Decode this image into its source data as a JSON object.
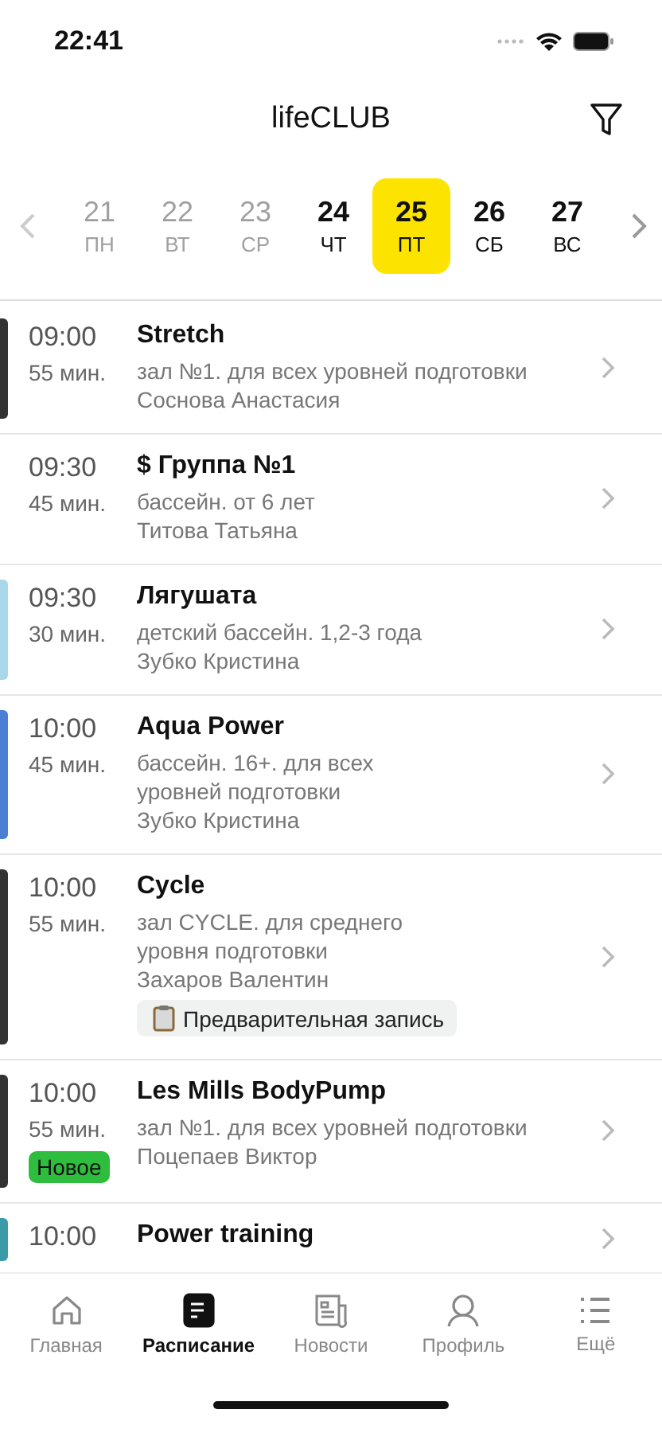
{
  "status_bar": {
    "time": "22:41"
  },
  "header": {
    "title": "lifeCLUB"
  },
  "days": [
    {
      "date": "21",
      "weekday": "ПН",
      "past": true,
      "selected": false
    },
    {
      "date": "22",
      "weekday": "ВТ",
      "past": true,
      "selected": false
    },
    {
      "date": "23",
      "weekday": "СР",
      "past": true,
      "selected": false
    },
    {
      "date": "24",
      "weekday": "ЧТ",
      "past": false,
      "selected": false
    },
    {
      "date": "25",
      "weekday": "ПТ",
      "past": false,
      "selected": true
    },
    {
      "date": "26",
      "weekday": "СБ",
      "past": false,
      "selected": false
    },
    {
      "date": "27",
      "weekday": "ВС",
      "past": false,
      "selected": false
    }
  ],
  "classes": [
    {
      "time": "09:00",
      "duration": "55 мин.",
      "title": "Stretch",
      "details": [
        "зал №1. для всех уровней подготовки",
        "Соснова Анастасия"
      ],
      "color": "#333333"
    },
    {
      "time": "09:30",
      "duration": "45 мин.",
      "title": "$ Группа №1",
      "details": [
        "бассейн. от 6 лет",
        "Титова Татьяна"
      ]
    },
    {
      "time": "09:30",
      "duration": "30 мин.",
      "title": "Лягушата",
      "details": [
        "детский  бассейн. 1,2-3 года",
        "Зубко Кристина"
      ],
      "color": "#a8d8ea"
    },
    {
      "time": "10:00",
      "duration": "45 мин.",
      "title": "Aqua Power",
      "details": [
        "бассейн. 16+. для всех",
        "уровней подготовки",
        "Зубко Кристина"
      ],
      "color": "#4a7fd4"
    },
    {
      "time": "10:00",
      "duration": "55 мин.",
      "title": "Cycle",
      "details": [
        "зал CYCLE. для среднего",
        "уровня подготовки",
        "Захаров Валентин"
      ],
      "note": "Предварительная запись",
      "color": "#333333"
    },
    {
      "time": "10:00",
      "duration": "55 мин.",
      "title": "Les Mills BodyPump",
      "details": [
        "зал №1. для всех уровней подготовки",
        "Поцепаев Виктор"
      ],
      "badge": "Новое",
      "color": "#333333"
    },
    {
      "time": "10:00",
      "title": "Power training",
      "color": "#3a9aa8"
    }
  ],
  "tabs": [
    {
      "label": "Главная",
      "kind": "home",
      "selected": false
    },
    {
      "label": "Расписание",
      "kind": "schedule",
      "selected": true
    },
    {
      "label": "Новости",
      "kind": "news",
      "selected": false
    },
    {
      "label": "Профиль",
      "kind": "profile",
      "selected": false
    },
    {
      "label": "Ещё",
      "kind": "more",
      "selected": false
    }
  ]
}
